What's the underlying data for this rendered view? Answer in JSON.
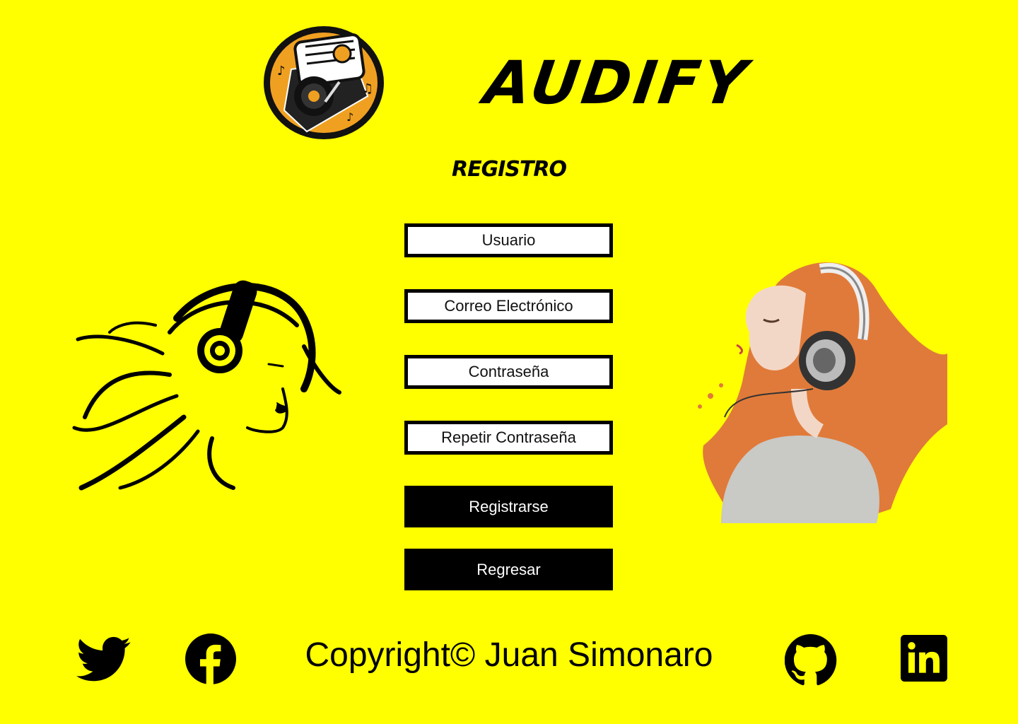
{
  "header": {
    "logo_icon": "vinyl-record-player-logo",
    "brand": "AUDIFY"
  },
  "page_title": "REGISTRO",
  "form": {
    "username_placeholder": "Usuario",
    "email_placeholder": "Correo Electrónico",
    "password_placeholder": "Contraseña",
    "repeat_password_placeholder": "Repetir Contraseña",
    "register_button": "Registrarse",
    "back_button": "Regresar"
  },
  "illustrations": {
    "left": "woman-headphones-line-art",
    "right": "girl-headphones-watercolor"
  },
  "footer": {
    "copyright": "Copyright© Juan Simonaro",
    "social": [
      "twitter-icon",
      "facebook-icon",
      "github-icon",
      "linkedin-icon"
    ]
  },
  "colors": {
    "background": "#ffff00",
    "text": "#000000",
    "field_bg": "#ffffff",
    "button_bg": "#000000",
    "button_text": "#ffffff",
    "logo_accent": "#f0a020"
  }
}
